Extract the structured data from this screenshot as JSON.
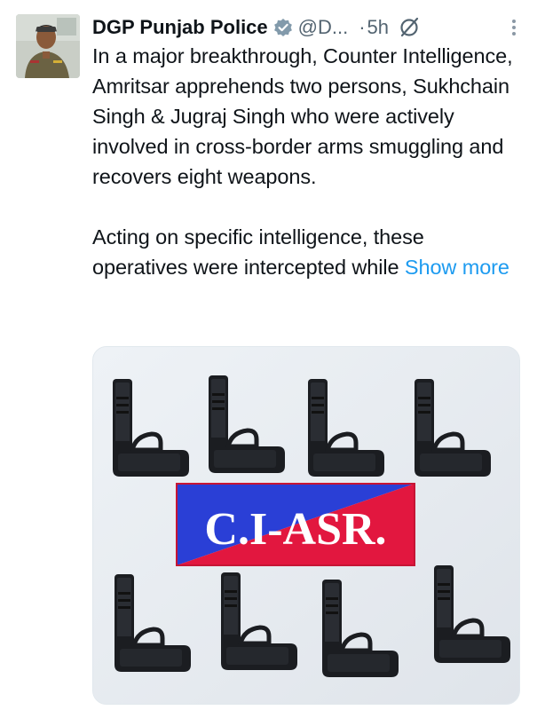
{
  "tweet": {
    "author": {
      "display_name": "DGP Punjab Police",
      "handle": "@D...",
      "verified_badge_icon": "verified-badge-icon",
      "avatar_icon": "avatar-photo"
    },
    "separator": "·",
    "timestamp": "5h",
    "grok_icon": "grok-slash-circle-icon",
    "more_icon": "vertical-dots-icon",
    "body": {
      "paragraph_1": "In a major breakthrough, Counter Intelligence, Amritsar apprehends two persons, Sukhchain Singh & Jugraj Singh who were actively involved in cross-border arms smuggling and recovers eight weapons.",
      "paragraph_2": "Acting on specific intelligence, these operatives were intercepted while",
      "show_more": "Show more"
    },
    "media": {
      "placard_text": "C.I-ASR.",
      "pistol_count": 8
    }
  },
  "colors": {
    "link": "#1d9bf0",
    "secondary_text": "#536471",
    "placard_blue": "#2a3fd6",
    "placard_red": "#e2173f"
  }
}
